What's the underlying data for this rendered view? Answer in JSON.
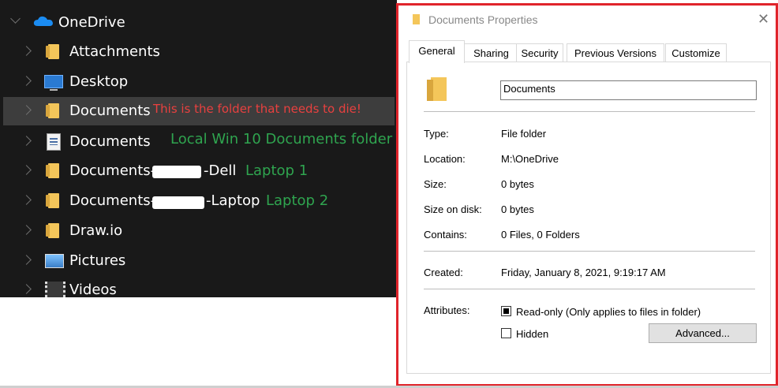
{
  "explorer": {
    "items": [
      {
        "label": "OneDrive",
        "icon": "onedrive-cloud-icon"
      },
      {
        "label": "Attachments",
        "icon": "folder-icon"
      },
      {
        "label": "Desktop",
        "icon": "desktop-icon"
      },
      {
        "label": "Documents",
        "icon": "folder-icon",
        "selected": true
      },
      {
        "label": "Documents",
        "icon": "document-icon"
      },
      {
        "label_before": "Documents-",
        "label_after": "-Dell",
        "icon": "folder-icon"
      },
      {
        "label_before": "Documents-",
        "label_after": "-Laptop",
        "icon": "folder-icon"
      },
      {
        "label": "Draw.io",
        "icon": "folder-icon"
      },
      {
        "label": "Pictures",
        "icon": "pictures-icon"
      },
      {
        "label": "Videos",
        "icon": "videos-icon"
      }
    ],
    "annotations": {
      "folder_to_die": "This is the folder that needs to die!",
      "local_documents": "Local Win 10 Documents folder",
      "laptop1": "Laptop 1",
      "laptop2": "Laptop 2"
    },
    "colors": {
      "background": "#191919",
      "red_note": "#e8403f",
      "green_note": "#2fa44f"
    }
  },
  "dialog": {
    "title": "Documents Properties",
    "close_icon": "close-icon",
    "tabs": [
      "General",
      "Sharing",
      "Security",
      "Previous Versions",
      "Customize"
    ],
    "active_tab": "General",
    "folder_name": "Documents",
    "properties": {
      "type_label": "Type:",
      "type_value": "File folder",
      "location_label": "Location:",
      "location_value": "M:\\OneDrive",
      "size_label": "Size:",
      "size_value": "0 bytes",
      "size_on_disk_label": "Size on disk:",
      "size_on_disk_value": "0 bytes",
      "contains_label": "Contains:",
      "contains_value": "0 Files, 0 Folders",
      "created_label": "Created:",
      "created_value": "Friday, January 8, 2021, 9:19:17 AM"
    },
    "attributes": {
      "label": "Attributes:",
      "readonly_label": "Read-only (Only applies to files in folder)",
      "readonly_state": "indeterminate",
      "hidden_label": "Hidden",
      "hidden_state": "unchecked",
      "advanced_button": "Advanced..."
    },
    "border_color": "#e0242b"
  }
}
